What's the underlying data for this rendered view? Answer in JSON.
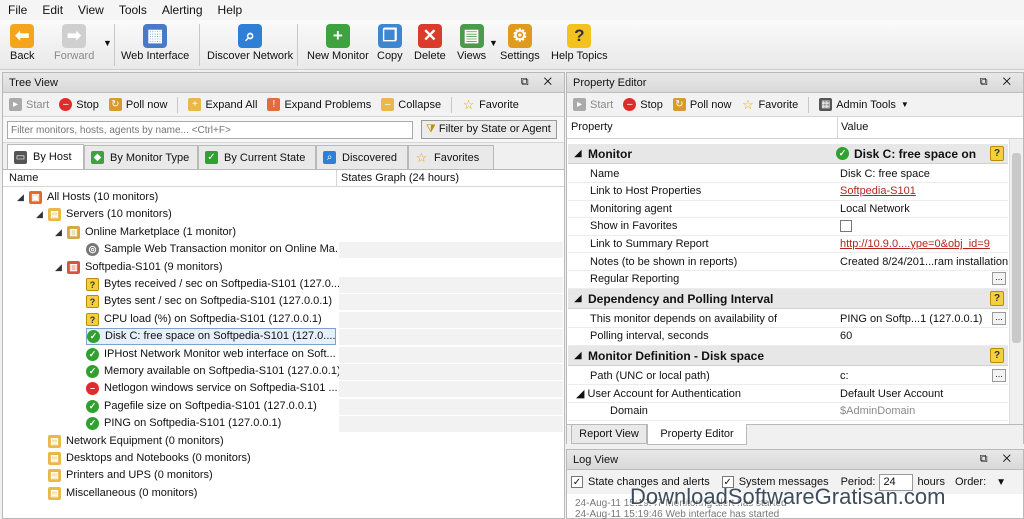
{
  "menu": [
    "File",
    "Edit",
    "View",
    "Tools",
    "Alerting",
    "Help"
  ],
  "toolbar": {
    "back": "Back",
    "forward": "Forward",
    "web_interface": "Web Interface",
    "discover_network": "Discover Network",
    "new_monitor": "New Monitor",
    "copy": "Copy",
    "delete": "Delete",
    "views": "Views",
    "settings": "Settings",
    "help_topics": "Help Topics"
  },
  "tree_view": {
    "title": "Tree View",
    "controls": "⧉ ✕",
    "actions": {
      "start": "Start",
      "stop": "Stop",
      "poll_now": "Poll now",
      "expand_all": "Expand All",
      "expand_problems": "Expand Problems",
      "collapse": "Collapse",
      "favorite": "Favorite"
    },
    "filter_placeholder": "Filter monitors, hosts, agents by name... <Ctrl+F>",
    "filter_button": "Filter by State or Agent",
    "tabs": [
      "By Host",
      "By Monitor Type",
      "By Current State",
      "Discovered",
      "Favorites"
    ],
    "col_name": "Name",
    "col_graph": "States Graph (24 hours)",
    "rows": [
      {
        "label": "All Hosts (10 monitors)",
        "icon": "hosts",
        "level": 0,
        "expanded": true
      },
      {
        "label": "Servers (10 monitors)",
        "icon": "group",
        "level": 1,
        "expanded": true
      },
      {
        "label": "Online Marketplace (1 monitor)",
        "icon": "host",
        "level": 2,
        "expanded": true
      },
      {
        "label": "Sample Web Transaction monitor on Online Ma...",
        "icon": "pending",
        "level": 3
      },
      {
        "label": "Softpedia-S101 (9 monitors)",
        "icon": "host-red",
        "level": 2,
        "expanded": true
      },
      {
        "label": "Bytes received / sec on Softpedia-S101 (127.0....",
        "icon": "unknown",
        "level": 3
      },
      {
        "label": "Bytes sent / sec on Softpedia-S101 (127.0.0.1)",
        "icon": "unknown",
        "level": 3
      },
      {
        "label": "CPU load (%) on Softpedia-S101 (127.0.0.1)",
        "icon": "unknown",
        "level": 3
      },
      {
        "label": "Disk C: free space on Softpedia-S101 (127.0....",
        "icon": "ok",
        "level": 3,
        "selected": true
      },
      {
        "label": "IPHost Network Monitor web interface on Soft...",
        "icon": "ok",
        "level": 3
      },
      {
        "label": "Memory available on Softpedia-S101 (127.0.0.1)",
        "icon": "ok",
        "level": 3
      },
      {
        "label": "Netlogon windows service on Softpedia-S101 ...",
        "icon": "error",
        "level": 3
      },
      {
        "label": "Pagefile size on Softpedia-S101 (127.0.0.1)",
        "icon": "ok",
        "level": 3
      },
      {
        "label": "PING on Softpedia-S101 (127.0.0.1)",
        "icon": "ok",
        "level": 3
      },
      {
        "label": "Network Equipment (0 monitors)",
        "icon": "group",
        "level": 1
      },
      {
        "label": "Desktops and Notebooks (0 monitors)",
        "icon": "group",
        "level": 1
      },
      {
        "label": "Printers and UPS (0 monitors)",
        "icon": "group",
        "level": 1
      },
      {
        "label": "Miscellaneous (0 monitors)",
        "icon": "group",
        "level": 1
      }
    ]
  },
  "property_editor": {
    "title": "Property Editor",
    "controls": "⧉ ✕",
    "actions": {
      "start": "Start",
      "stop": "Stop",
      "poll_now": "Poll now",
      "favorite": "Favorite",
      "admin_tools": "Admin Tools"
    },
    "col_property": "Property",
    "col_value": "Value",
    "sections": [
      {
        "name": "Monitor",
        "value": "Disk C: free space on",
        "rows": [
          {
            "p": "Name",
            "v": "Disk C: free space"
          },
          {
            "p": "Link to Host Properties",
            "v": "Softpedia-S101",
            "link": true
          },
          {
            "p": "Monitoring agent",
            "v": "Local Network"
          },
          {
            "p": "Show in Favorites",
            "v": "",
            "checkbox": true
          },
          {
            "p": "Link to Summary Report",
            "v": "http://10.9.0....ype=0&obj_id=9",
            "link": true
          },
          {
            "p": "Notes (to be shown in reports)",
            "v": "Created 8/24/201...ram installation"
          },
          {
            "p": "Regular Reporting",
            "v": "",
            "more": true
          }
        ]
      },
      {
        "name": "Dependency and Polling Interval",
        "value": "",
        "rows": [
          {
            "p": "This monitor depends on availability of",
            "v": "PING on Softp...1 (127.0.0.1)",
            "more": true
          },
          {
            "p": "Polling interval, seconds",
            "v": "60"
          }
        ]
      },
      {
        "name": "Monitor Definition - Disk space",
        "value": "",
        "rows": [
          {
            "p": "Path (UNC or local path)",
            "v": "c:",
            "more": true
          },
          {
            "p": "User Account for Authentication",
            "v": "Default User Account",
            "expanded": true
          },
          {
            "p": "Domain",
            "v": "$AdminDomain",
            "sub": true,
            "grey": true
          }
        ]
      }
    ],
    "bottom_tabs": [
      "Report View",
      "Property Editor"
    ]
  },
  "log_view": {
    "title": "Log View",
    "controls": "⧉ ✕",
    "state_changes": "State changes and alerts",
    "system_messages": "System messages",
    "period_label": "Period:",
    "period_value": "24",
    "hours": "hours",
    "order": "Order:",
    "line1": "24-Aug-11 15:19:47 Monitoring alert has started",
    "line2": "24-Aug-11 15:19:46 Web interface has started"
  },
  "watermark": "DownloadSoftwareGratisan.com"
}
